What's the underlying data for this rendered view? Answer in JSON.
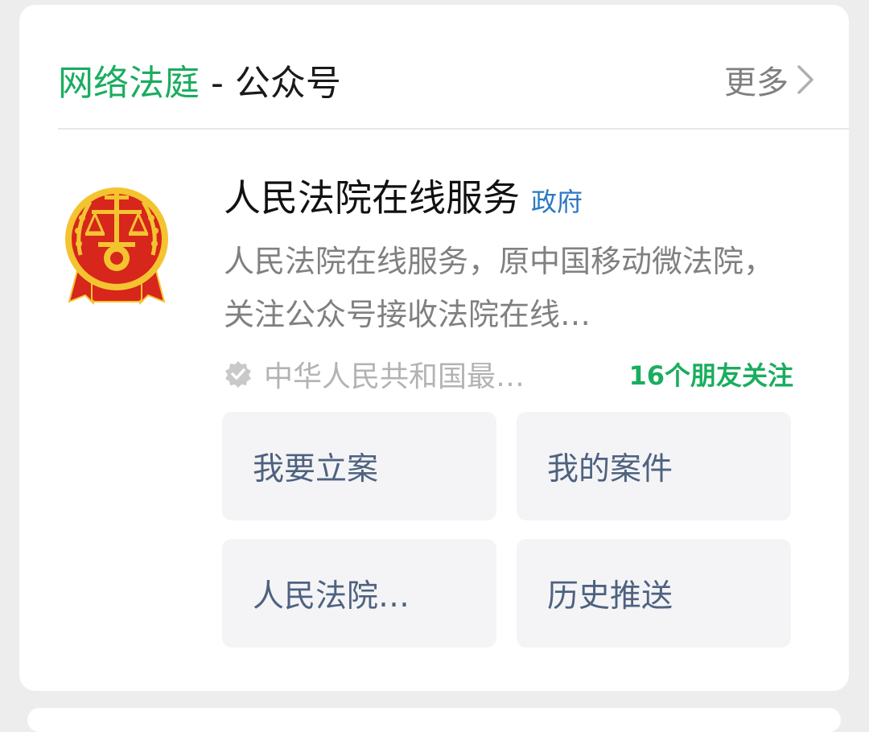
{
  "section": {
    "title_highlight": "网络法庭",
    "title_rest": " - 公众号",
    "more_label": "更多"
  },
  "account": {
    "name": "人民法院在线服务",
    "badge": "政府",
    "description": "人民法院在线服务，原中国移动微法院，关注公众号接收法院在线…",
    "organization": "中华人民共和国最…",
    "friends_following": "16个朋友关注",
    "logo_icon": "court-emblem-icon"
  },
  "menu": {
    "items": [
      {
        "label": "我要立案"
      },
      {
        "label": "我的案件"
      },
      {
        "label": "人民法院…"
      },
      {
        "label": "历史推送"
      }
    ]
  },
  "colors": {
    "highlight_green": "#1aad5f",
    "badge_blue": "#2b79c4",
    "menu_text": "#4e6280",
    "emblem_red": "#d7261b",
    "emblem_gold": "#f4c430"
  }
}
